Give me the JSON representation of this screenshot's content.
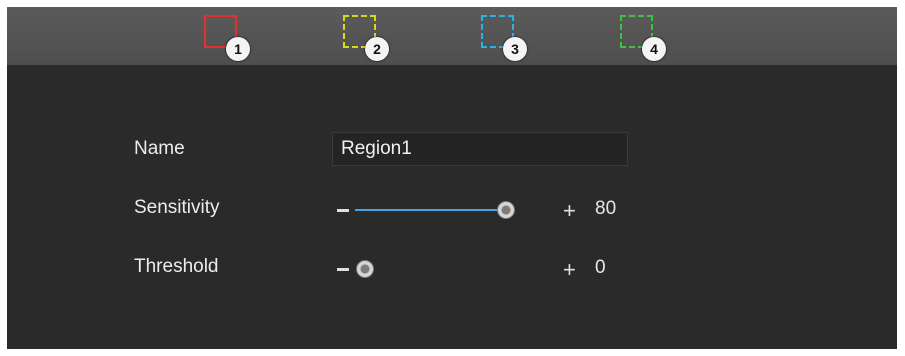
{
  "regions": [
    {
      "number": "1",
      "color": "#e03030",
      "style": "solid"
    },
    {
      "number": "2",
      "color": "#d8d820",
      "style": "dashed"
    },
    {
      "number": "3",
      "color": "#30b0e0",
      "style": "dashed"
    },
    {
      "number": "4",
      "color": "#40c040",
      "style": "dashed"
    }
  ],
  "form": {
    "name_label": "Name",
    "name_value": "Region1",
    "sensitivity_label": "Sensitivity",
    "sensitivity_value": "80",
    "threshold_label": "Threshold",
    "threshold_value": "0"
  },
  "sliders": {
    "sensitivity": {
      "value": 80,
      "min": 0,
      "max": 100
    },
    "threshold": {
      "value": 0,
      "min": 0,
      "max": 100
    }
  },
  "icons": {
    "minus": "minus-icon",
    "plus": "plus-icon"
  },
  "colors": {
    "slider_fill": "#4aa3e0"
  }
}
